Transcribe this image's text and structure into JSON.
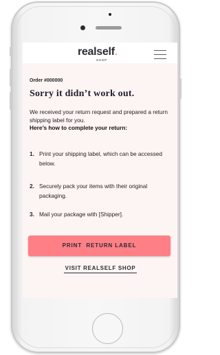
{
  "header": {
    "logo_text": "realself",
    "logo_dot": ".",
    "logo_subtitle": "SHOP",
    "menu_icon": "hamburger-menu-icon"
  },
  "content": {
    "order_label": "Order #000000",
    "title": "Sorry it didn’t work out.",
    "intro": "We received your return request and prepared a return shipping label for you.",
    "instructions_heading": "Here’s how to complete your return:",
    "steps": [
      {
        "num": "1.",
        "text": "Print your shipping label, which can be accessed below."
      },
      {
        "num": "2.",
        "text": "Securely pack your items with their original packaging."
      },
      {
        "num": "3.",
        "text": "Mail your package with [Shipper]."
      }
    ]
  },
  "actions": {
    "primary_label": "PRINT  RETURN LABEL",
    "secondary_label": "VISIT REALSELF SHOP"
  },
  "colors": {
    "accent": "#ff7f86",
    "screen_bg": "#fdf5f3",
    "text": "#2a2a33"
  }
}
